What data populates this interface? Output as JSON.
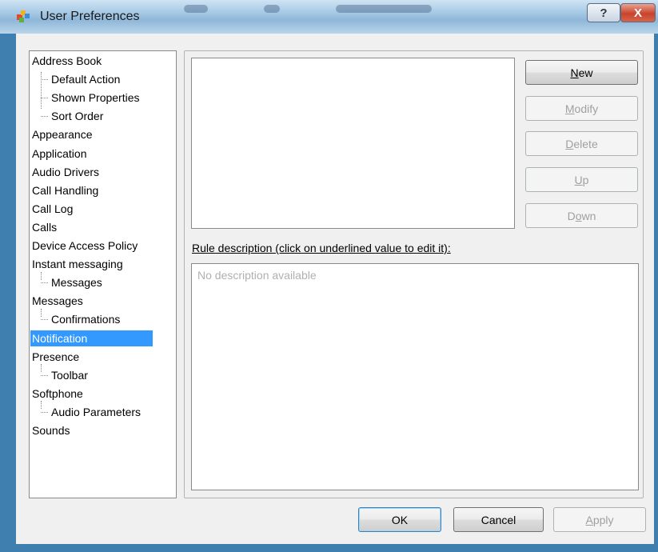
{
  "window": {
    "title": "User Preferences",
    "help_glyph": "?",
    "close_glyph": "X"
  },
  "tree": {
    "items": [
      {
        "label": "Address Book",
        "level": 0
      },
      {
        "label": "Default Action",
        "level": 1
      },
      {
        "label": "Shown Properties",
        "level": 1
      },
      {
        "label": "Sort Order",
        "level": 1
      },
      {
        "label": "Appearance",
        "level": 0
      },
      {
        "label": "Application",
        "level": 0
      },
      {
        "label": "Audio Drivers",
        "level": 0
      },
      {
        "label": "Call Handling",
        "level": 0
      },
      {
        "label": "Call Log",
        "level": 0
      },
      {
        "label": "Calls",
        "level": 0
      },
      {
        "label": "Device Access Policy",
        "level": 0
      },
      {
        "label": "Instant messaging",
        "level": 0
      },
      {
        "label": "Messages",
        "level": 1
      },
      {
        "label": "Messages",
        "level": 0
      },
      {
        "label": "Confirmations",
        "level": 1
      },
      {
        "label": "Notification",
        "level": 0,
        "selected": true
      },
      {
        "label": "Presence",
        "level": 0
      },
      {
        "label": "Toolbar",
        "level": 1
      },
      {
        "label": "Softphone",
        "level": 0
      },
      {
        "label": "Audio Parameters",
        "level": 1
      },
      {
        "label": "Sounds",
        "level": 0
      }
    ]
  },
  "rule_buttons": {
    "new": {
      "pre": "",
      "key": "N",
      "post": "ew",
      "enabled": true
    },
    "modify": {
      "pre": "",
      "key": "M",
      "post": "odify",
      "enabled": false
    },
    "delete": {
      "pre": "",
      "key": "D",
      "post": "elete",
      "enabled": false
    },
    "up": {
      "pre": "",
      "key": "U",
      "post": "p",
      "enabled": false
    },
    "down": {
      "pre": "D",
      "key": "o",
      "post": "wn",
      "enabled": false
    }
  },
  "description": {
    "label": "Rule description (click on underlined value to edit it):",
    "text": "No description available"
  },
  "footer": {
    "ok": "OK",
    "cancel": "Cancel",
    "apply": {
      "pre": "",
      "key": "A",
      "post": "pply"
    }
  },
  "colors": {
    "selection": "#3399ff",
    "title_bar": "#a9cbe6",
    "close_button": "#c8432c",
    "frame": "#3f7fb0"
  },
  "icons": {
    "app": "app-preferences-icon",
    "help": "help-icon",
    "close": "close-icon"
  }
}
